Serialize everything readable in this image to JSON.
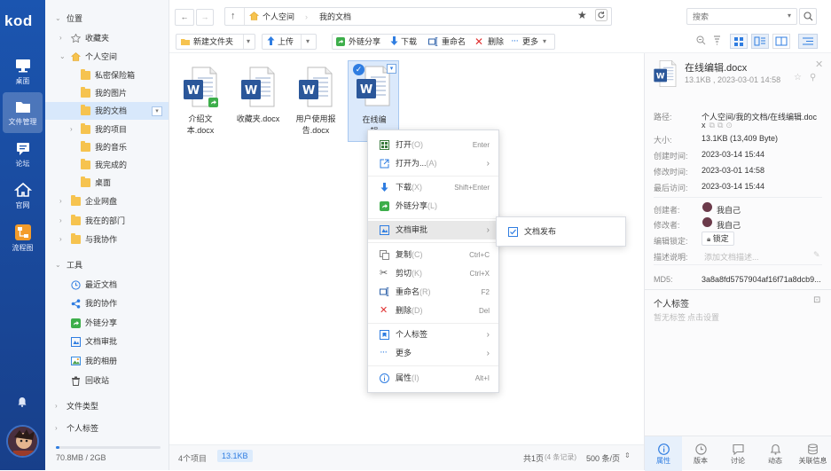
{
  "app": {
    "logo": "kod"
  },
  "dock": {
    "items": [
      {
        "label": "桌面",
        "icon": "monitor-icon"
      },
      {
        "label": "文件管理",
        "icon": "folder-icon"
      },
      {
        "label": "论坛",
        "icon": "chat-icon"
      },
      {
        "label": "官网",
        "icon": "home-icon"
      },
      {
        "label": "流程图",
        "icon": "flowchart-icon"
      }
    ]
  },
  "tree": {
    "location": "位置",
    "favorites": "收藏夹",
    "personal": "个人空间",
    "safe_box": "私密保险箱",
    "my_pictures": "我的图片",
    "my_documents": "我的文档",
    "my_projects": "我的项目",
    "my_music": "我的音乐",
    "completed": "我完成的",
    "desktop": "桌面",
    "enterprise": "企业网盘",
    "my_department": "我在的部门",
    "collab": "与我协作",
    "tools": "工具",
    "recent": "最近文档",
    "my_collab": "我的协作",
    "share_link": "外链分享",
    "doc_review": "文档审批",
    "my_album": "我的相册",
    "recycle": "回收站",
    "file_types": "文件类型",
    "personal_tags": "个人标签",
    "storage": "70.8MB / 2GB",
    "storage_fraction": 0.035
  },
  "path": {
    "root": "个人空间",
    "current": "我的文档"
  },
  "search": {
    "placeholder": "搜索"
  },
  "toolbar": {
    "new_folder": "新建文件夹",
    "upload": "上传",
    "share": "外链分享",
    "download": "下载",
    "rename": "重命名",
    "delete": "删除",
    "more": "更多"
  },
  "files": [
    {
      "name": "介绍文本.docx",
      "line1": "介绍文",
      "line2": "本.docx",
      "shared": true
    },
    {
      "name": "收藏夹.docx",
      "line1": "收藏夹.docx",
      "line2": "",
      "shared": false
    },
    {
      "name": "用户使用报告.docx",
      "line1": "用户使用报",
      "line2": "告.docx",
      "shared": false
    },
    {
      "name": "在线编辑.docx",
      "line1": "在线编",
      "line2": "辑",
      "shared": false,
      "selected": true
    }
  ],
  "context_menu": {
    "open": "打开",
    "open_key": "(O)",
    "open_sc": "Enter",
    "open_with": "打开为...",
    "open_with_key": "(A)",
    "download": "下载",
    "download_key": "(X)",
    "download_sc": "Shift+Enter",
    "share": "外链分享",
    "share_key": "(L)",
    "review": "文档审批",
    "copy": "复制",
    "copy_key": "(C)",
    "copy_sc": "Ctrl+C",
    "cut": "剪切",
    "cut_key": "(K)",
    "cut_sc": "Ctrl+X",
    "rename": "重命名",
    "rename_key": "(R)",
    "rename_sc": "F2",
    "delete": "删除",
    "delete_key": "(D)",
    "delete_sc": "Del",
    "tags": "个人标签",
    "more": "更多",
    "props": "属性",
    "props_key": "(I)",
    "props_sc": "Alt+I"
  },
  "submenu": {
    "publish": "文档发布"
  },
  "status": {
    "count": "4个项目",
    "size": "13.1KB",
    "page": "共1页",
    "records": "(4 条记录)",
    "per_page": "500 条/页"
  },
  "details": {
    "filename": "在线编辑.docx",
    "meta": "13.1KB , 2023-03-01 14:58",
    "path_label": "路径:",
    "path_value": "个人空间/我的文档/在线编辑.doc",
    "path_value2": "x",
    "size_label": "大小:",
    "size_value": "13.1KB (13,409 Byte)",
    "created_label": "创建时间:",
    "created_value": "2023-03-14 15:44",
    "modified_label": "修改时间:",
    "modified_value": "2023-03-01 14:58",
    "accessed_label": "最后访问:",
    "accessed_value": "2023-03-14 15:44",
    "creator_label": "创建者:",
    "creator_value": "我自己",
    "modifier_label": "修改者:",
    "modifier_value": "我自己",
    "lock_label": "编辑锁定:",
    "lock_value": "锁定",
    "desc_label": "描述说明:",
    "desc_placeholder": "添加文档描述...",
    "md5_label": "MD5:",
    "md5_value": "3a8a8fd5757904af16f71a8dcb9...",
    "tags_title": "个人标签",
    "tags_empty": "暂无标签",
    "tags_set": "点击设置"
  },
  "bottom_tabs": [
    {
      "label": "属性",
      "icon": "info-icon",
      "active": true
    },
    {
      "label": "版本",
      "icon": "clock-icon"
    },
    {
      "label": "讨论",
      "icon": "comment-icon"
    },
    {
      "label": "动态",
      "icon": "bell-icon"
    },
    {
      "label": "关联信息",
      "icon": "database-icon"
    }
  ],
  "colors": {
    "accent": "#2f7de1",
    "dock": "#1b55b0",
    "word_blue": "#2b579a"
  }
}
